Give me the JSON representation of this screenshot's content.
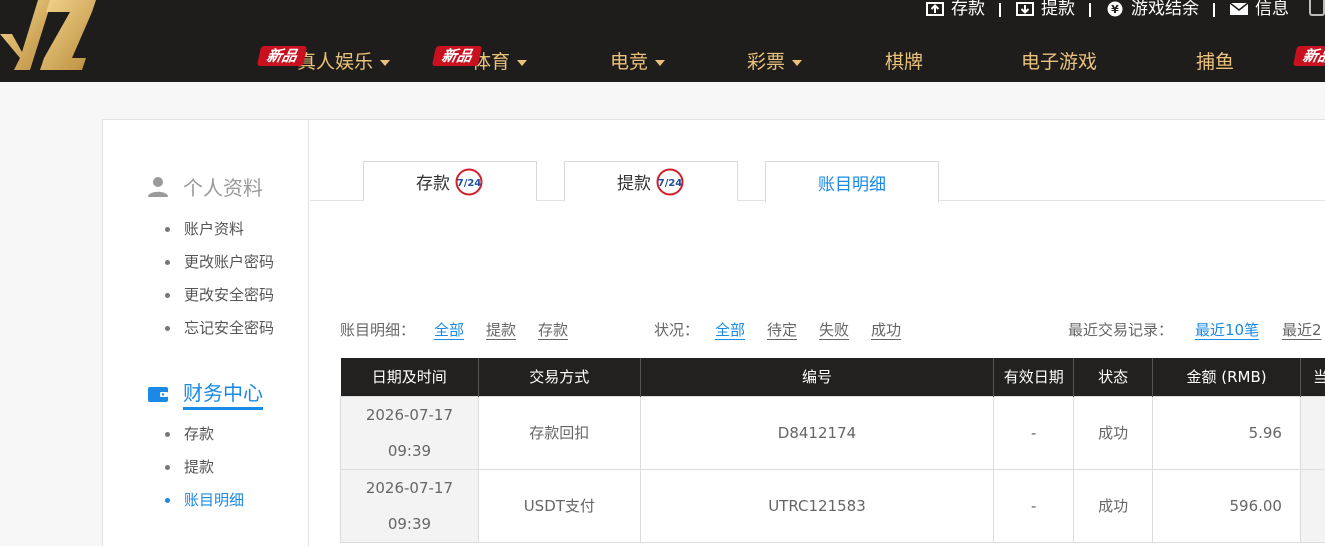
{
  "header": {
    "top_links": [
      {
        "label": "存款",
        "icon": "deposit-icon"
      },
      {
        "label": "提款",
        "icon": "withdraw-icon"
      },
      {
        "label": "游戏结余",
        "icon": "balance-icon"
      },
      {
        "label": "信息",
        "icon": "mail-icon"
      }
    ],
    "new_badge": "新品",
    "nav": [
      {
        "label": "真人娱乐",
        "dropdown": true,
        "badge": true
      },
      {
        "label": "体育",
        "dropdown": true,
        "badge": true
      },
      {
        "label": "电竞",
        "dropdown": true,
        "badge": false
      },
      {
        "label": "彩票",
        "dropdown": true,
        "badge": false
      },
      {
        "label": "棋牌",
        "dropdown": false,
        "badge": false
      },
      {
        "label": "电子游戏",
        "dropdown": false,
        "badge": false
      },
      {
        "label": "捕鱼",
        "dropdown": false,
        "badge": false
      }
    ],
    "colors": {
      "bar": "#1f1d1b",
      "nav_text": "#e9c17a",
      "badge": "#c8101f"
    }
  },
  "sidebar": {
    "personal": {
      "title": "个人资料",
      "items": [
        "账户资料",
        "更改账户密码",
        "更改安全密码",
        "忘记安全密码"
      ]
    },
    "finance": {
      "title": "财务中心",
      "items": [
        "存款",
        "提款",
        "账目明细"
      ],
      "active": "账目明细"
    }
  },
  "tabs": [
    {
      "label": "存款",
      "badge": "7/24",
      "active": false
    },
    {
      "label": "提款",
      "badge": "7/24",
      "active": false
    },
    {
      "label": "账目明细",
      "active": true
    }
  ],
  "filters": {
    "type_label": "账目明细：",
    "type_options": [
      "全部",
      "提款",
      "存款"
    ],
    "status_label": "状况：",
    "status_options": [
      "全部",
      "待定",
      "失败",
      "成功"
    ],
    "recent_label": "最近交易记录：",
    "recent_options": [
      "最近10笔",
      "最近2"
    ]
  },
  "table": {
    "columns": [
      "日期及时间",
      "交易方式",
      "编号",
      "有效日期",
      "状态",
      "金额 (RMB)",
      "当"
    ],
    "rows": [
      {
        "date": "2026-07-17",
        "time": "09:39",
        "method": "存款回扣",
        "id": "D8412174",
        "valid": "-",
        "status": "成功",
        "amount": "5.96"
      },
      {
        "date": "2026-07-17",
        "time": "09:39",
        "method": "USDT支付",
        "id": "UTRC121583",
        "valid": "-",
        "status": "成功",
        "amount": "596.00"
      }
    ]
  },
  "accent_color": "#1a8ae6"
}
